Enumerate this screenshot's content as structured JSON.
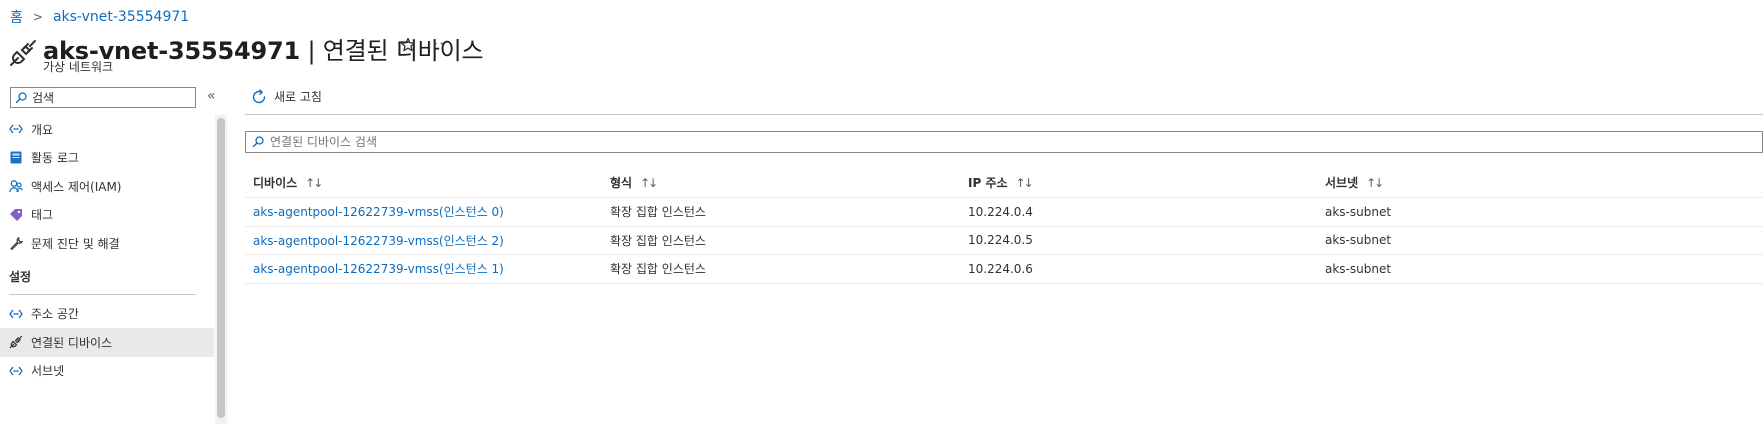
{
  "breadcrumb": {
    "home": "홈",
    "current": "aks-vnet-35554971"
  },
  "header": {
    "resource_name": "aks-vnet-35554971",
    "separator": " | ",
    "page_name": "연결된 디바이스",
    "subtitle": "가상 네트워크",
    "favorite_icon": "star-icon",
    "more_label": "···"
  },
  "nav": {
    "search_value": "검색",
    "collapse_label": "«",
    "items_top": [
      {
        "label": "개요",
        "icon": "overview-icon"
      },
      {
        "label": "활동 로그",
        "icon": "activity-log-icon"
      },
      {
        "label": "액세스 제어(IAM)",
        "icon": "iam-icon"
      },
      {
        "label": "태그",
        "icon": "tag-icon"
      },
      {
        "label": "문제 진단 및 해결",
        "icon": "wrench-icon"
      }
    ],
    "section_settings": "설정",
    "items_settings": [
      {
        "label": "주소 공간",
        "icon": "address-space-icon"
      },
      {
        "label": "연결된 디바이스",
        "icon": "plug-icon",
        "selected": true
      },
      {
        "label": "서브넷",
        "icon": "subnet-icon"
      }
    ]
  },
  "toolbar": {
    "refresh_label": "새로 고침"
  },
  "filter": {
    "placeholder": "연결된 디바이스 검색"
  },
  "table": {
    "columns": [
      "디바이스",
      "형식",
      "IP 주소",
      "서브넷"
    ],
    "sort_glyph": "↑↓",
    "rows": [
      {
        "device": "aks-agentpool-12622739-vmss(인스턴스 0)",
        "type": "확장 집합 인스턴스",
        "ip": "10.224.0.4",
        "subnet": "aks-subnet"
      },
      {
        "device": "aks-agentpool-12622739-vmss(인스턴스 2)",
        "type": "확장 집합 인스턴스",
        "ip": "10.224.0.5",
        "subnet": "aks-subnet"
      },
      {
        "device": "aks-agentpool-12622739-vmss(인스턴스 1)",
        "type": "확장 집합 인스턴스",
        "ip": "10.224.0.6",
        "subnet": "aks-subnet"
      }
    ]
  },
  "colors": {
    "link": "#0f6cbd",
    "selected_bg": "#e9e9e9",
    "border": "#8a8886"
  }
}
